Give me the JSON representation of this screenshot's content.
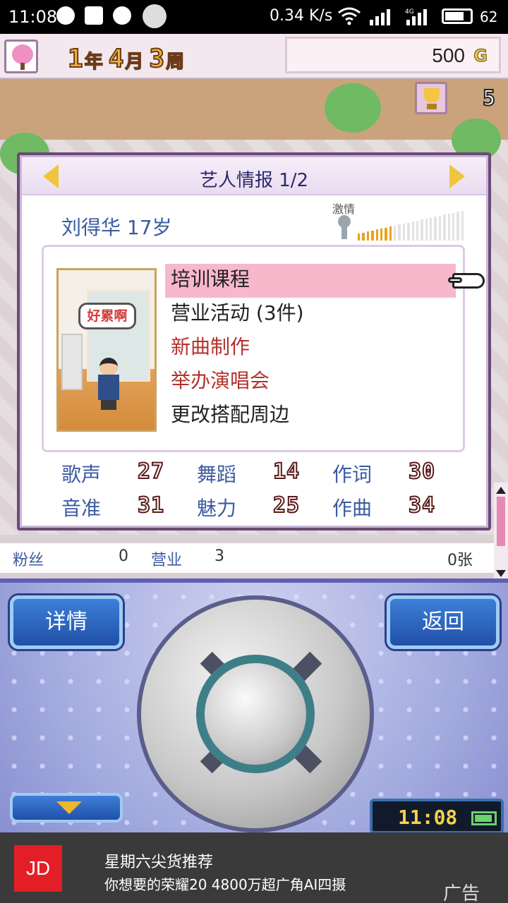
{
  "status_bar": {
    "time": "11:08",
    "net_speed": "0.34 K/s",
    "network": "4G",
    "battery": "62",
    "icons": [
      "qq-icon",
      "mail-icon",
      "check-icon",
      "panda-icon",
      "wifi-icon",
      "signal-icon",
      "battery-icon"
    ]
  },
  "game": {
    "date": {
      "year": "1",
      "year_unit": "年",
      "month": "4",
      "month_unit": "月",
      "week": "3",
      "week_unit": "周"
    },
    "gold": {
      "amount": "500",
      "unit": "G"
    },
    "trophy_count": "5",
    "dialog": {
      "title": "艺人情报 1/2",
      "artist": "刘得华 17岁",
      "passion_label": "激情",
      "passion_level": 0.33,
      "portrait_speech": "好累啊",
      "menu": [
        {
          "label": "培训课程",
          "selected": true,
          "color": "#222222"
        },
        {
          "label": "营业活动 (3件)",
          "selected": false,
          "color": "#222222"
        },
        {
          "label": "新曲制作",
          "selected": false,
          "color": "#b4312c"
        },
        {
          "label": "举办演唱会",
          "selected": false,
          "color": "#b4312c"
        },
        {
          "label": "更改搭配周边",
          "selected": false,
          "color": "#222222"
        }
      ],
      "stats": [
        {
          "label": "歌声",
          "value": "27"
        },
        {
          "label": "舞蹈",
          "value": "14"
        },
        {
          "label": "作词",
          "value": "30"
        },
        {
          "label": "音准",
          "value": "31"
        },
        {
          "label": "魅力",
          "value": "25"
        },
        {
          "label": "作曲",
          "value": "34"
        }
      ]
    },
    "info_row": {
      "fans_label": "粉丝",
      "fans_value": "0",
      "business_label": "营业",
      "business_value": "3",
      "songs_value": "0张"
    }
  },
  "panel": {
    "detail_button": "详情",
    "back_button": "返回",
    "clock": "11:08"
  },
  "ad": {
    "logo": "JD",
    "line1": "星期六尖货推荐",
    "line2": "你想要的荣耀20 4800万超广角AI四摄",
    "label": "广告"
  },
  "colors": {
    "accent": "#f7b8cc",
    "menu_red": "#b4312c",
    "panel": "#a6aee0",
    "dialog_border": "#6a4a78"
  }
}
